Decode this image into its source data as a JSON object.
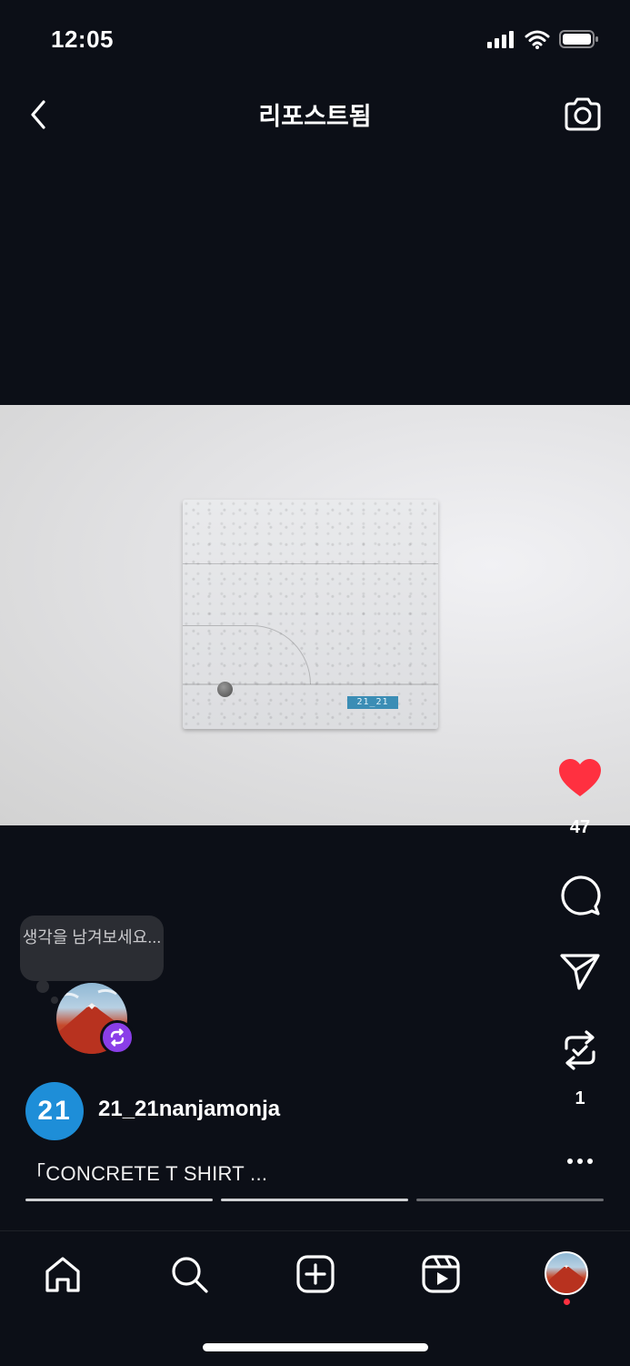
{
  "status_bar": {
    "time": "12:05"
  },
  "header": {
    "title": "리포스트됨"
  },
  "post": {
    "shirt_tag_text": "21_21",
    "likes": "47",
    "reposts": "1"
  },
  "note": {
    "text": "생각을 남겨보세요..."
  },
  "author": {
    "avatar_text": "21",
    "username": "21_21nanjamonja"
  },
  "caption": "「CONCRETE T SHIRT ...",
  "progress": [
    {
      "filled": 1
    },
    {
      "filled": 1
    },
    {
      "filled": 0
    }
  ],
  "colors": {
    "background": "#0c0f17",
    "like": "#ff3040",
    "accent_purple": "#8a3ee8",
    "avatar_blue": "#1e8ed8"
  },
  "icons": {
    "back": "chevron-left-icon",
    "camera": "camera-icon",
    "like": "heart-icon",
    "comment": "comment-icon",
    "share": "send-icon",
    "repost": "repost-icon",
    "more": "more-icon",
    "tabs": [
      "home-icon",
      "search-icon",
      "create-icon",
      "reels-icon",
      "profile-icon"
    ]
  }
}
